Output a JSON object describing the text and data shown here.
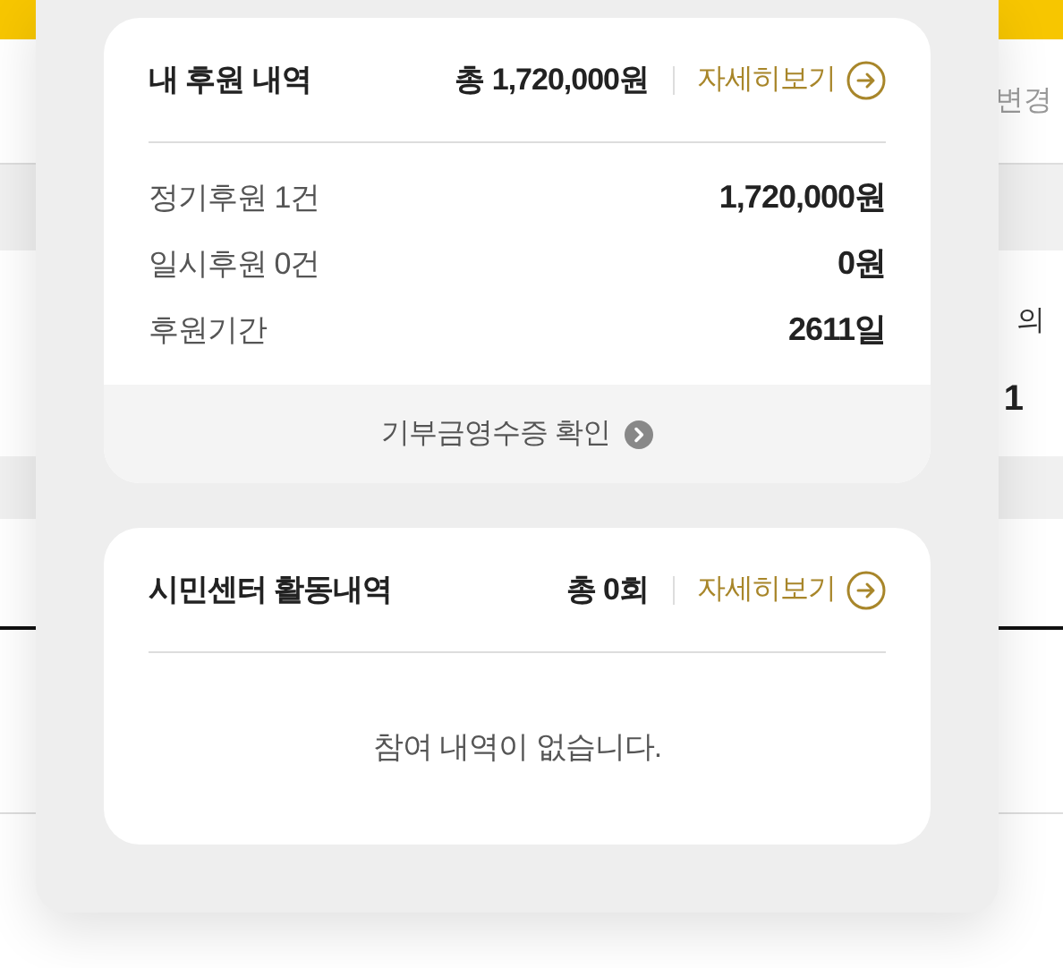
{
  "background": {
    "header_label": "변경",
    "side_label": "의",
    "side_count": "1"
  },
  "donation_summary": {
    "title": "내 후원 내역",
    "total": "총 1,720,000원",
    "more_link": "자세히보기",
    "rows": [
      {
        "label": "정기후원 1건",
        "value": "1,720,000원"
      },
      {
        "label": "일시후원 0건",
        "value": "0원"
      },
      {
        "label": "후원기간",
        "value": "2611일"
      }
    ],
    "footer_link": "기부금영수증 확인"
  },
  "activity_summary": {
    "title": "시민센터 활동내역",
    "total": "총 0회",
    "more_link": "자세히보기",
    "empty_message": "참여 내역이 없습니다."
  }
}
